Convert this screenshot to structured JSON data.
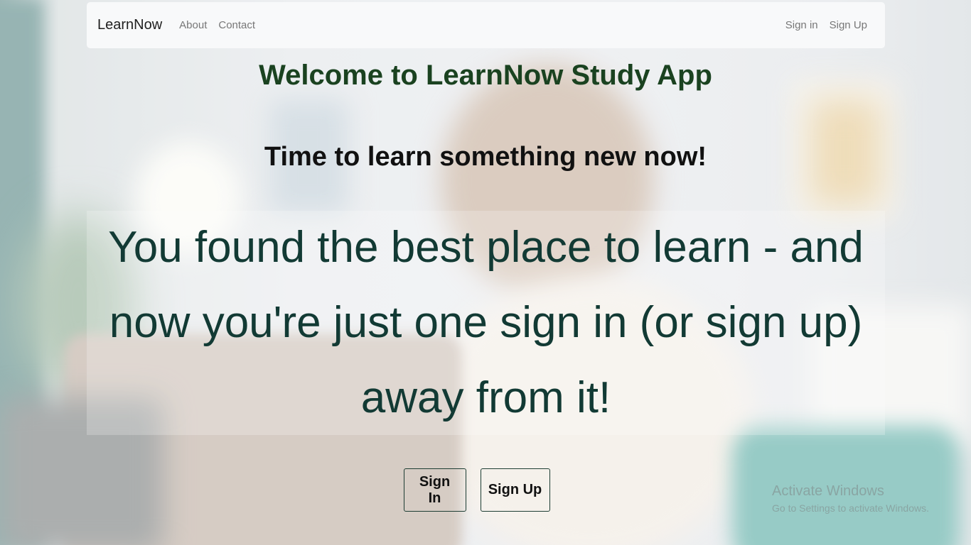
{
  "navbar": {
    "brand": "LearnNow",
    "links": [
      "About",
      "Contact"
    ],
    "right_links": [
      "Sign in",
      "Sign Up"
    ]
  },
  "hero": {
    "title": "Welcome to LearnNow Study App",
    "subtitle": "Time to learn something new now!",
    "message": "You found the best place to learn - and now you're just one sign in (or sign up) away from it!"
  },
  "actions": {
    "sign_in": "Sign In",
    "sign_up": "Sign Up"
  },
  "watermark": {
    "title": "Activate Windows",
    "subtitle": "Go to Settings to activate Windows."
  },
  "colors": {
    "title": "#1a4220",
    "message": "#123a34",
    "navbar_bg": "#f8f9fa"
  }
}
